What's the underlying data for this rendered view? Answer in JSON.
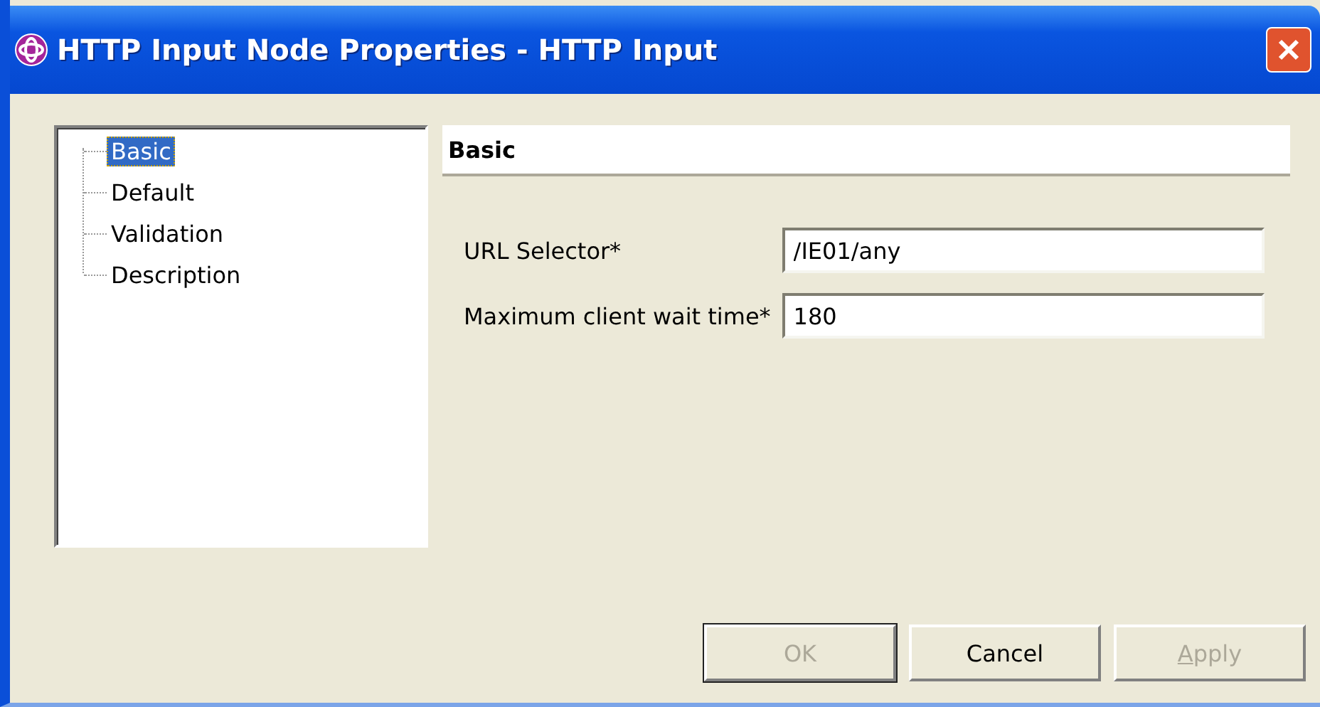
{
  "window": {
    "title": "HTTP Input Node Properties - HTTP Input"
  },
  "tree": {
    "items": [
      {
        "label": "Basic",
        "selected": true
      },
      {
        "label": "Default",
        "selected": false
      },
      {
        "label": "Validation",
        "selected": false
      },
      {
        "label": "Description",
        "selected": false
      }
    ]
  },
  "section": {
    "title": "Basic"
  },
  "fields": [
    {
      "label": "URL Selector*",
      "value": "/IE01/any"
    },
    {
      "label": "Maximum client wait time*",
      "value": "180"
    }
  ],
  "buttons": [
    {
      "label": "OK",
      "disabled": true,
      "default": true,
      "mnemonic": false
    },
    {
      "label": "Cancel",
      "disabled": false,
      "default": false,
      "mnemonic": false
    },
    {
      "label": "Apply",
      "disabled": true,
      "default": false,
      "mnemonic": true
    }
  ]
}
